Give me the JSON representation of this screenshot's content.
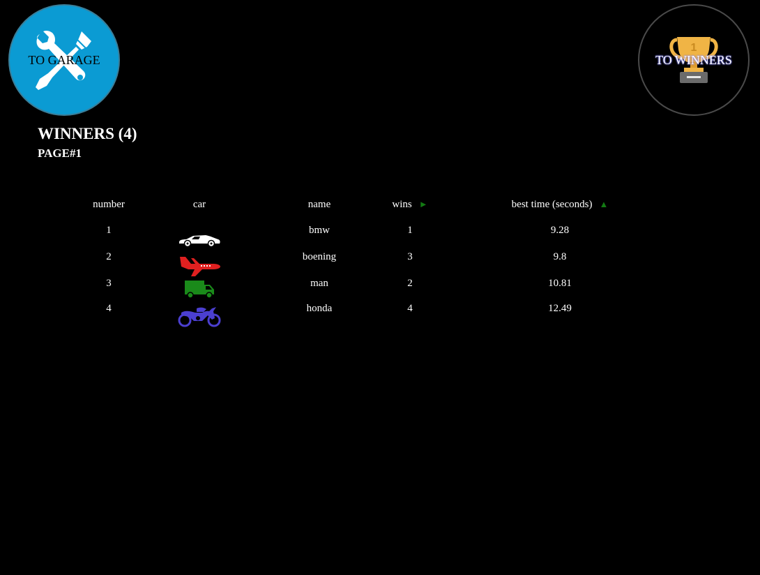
{
  "nav": {
    "garage_label": "TO GARAGE",
    "garage_icon": "tools-icon",
    "winners_label": "TO WINNERS",
    "winners_icon": "trophy-icon"
  },
  "header": {
    "title": "WINNERS (4)",
    "page": "PAGE#1"
  },
  "table": {
    "columns": {
      "number": "number",
      "car": "car",
      "name": "name",
      "wins": "wins",
      "best_time": "best time (seconds)"
    },
    "wins_sort_icon": "triangle-right-icon",
    "best_time_sort_icon": "triangle-up-icon",
    "rows": [
      {
        "number": "1",
        "car_type": "sports-car",
        "color": "#ffffff",
        "name": "bmw",
        "wins": "1",
        "best_time": "9.28"
      },
      {
        "number": "2",
        "car_type": "airplane",
        "color": "#e02020",
        "name": "boening",
        "wins": "3",
        "best_time": "9.8"
      },
      {
        "number": "3",
        "car_type": "truck",
        "color": "#1a8a1a",
        "name": "man",
        "wins": "2",
        "best_time": "10.81"
      },
      {
        "number": "4",
        "car_type": "motorcycle",
        "color": "#4b3fd0",
        "name": "honda",
        "wins": "4",
        "best_time": "12.49"
      }
    ]
  },
  "colors": {
    "background": "#000000",
    "garage_button": "#0b9bd3",
    "sort_arrow": "#137a13",
    "trophy": "#f0b445"
  }
}
